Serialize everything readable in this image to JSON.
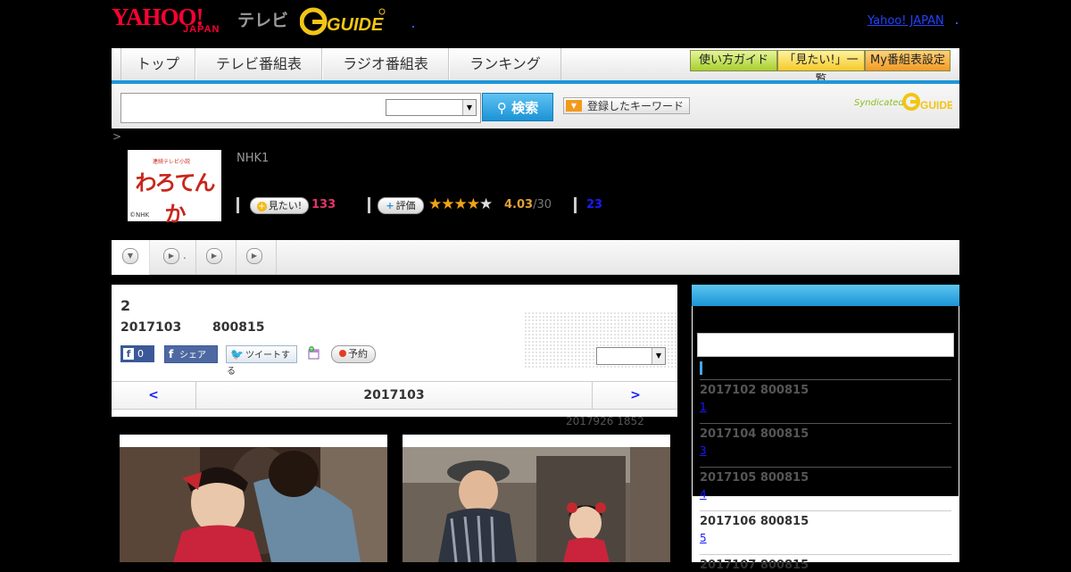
{
  "header": {
    "logo_yahoo": "YAHOO!",
    "logo_japan": "JAPAN",
    "logo_tv": "テレビ",
    "logo_gguide": "G-GUIDE",
    "yahoo_japan_link": "Yahoo! JAPAN"
  },
  "nav": {
    "tabs": [
      "トップ",
      "テレビ番組表",
      "ラジオ番組表",
      "ランキング"
    ],
    "guide_buttons": [
      "使い方ガイド",
      "「見たい!」一覧",
      "My番組表設定"
    ]
  },
  "search": {
    "query": "",
    "select_value": "",
    "button_label": "検索",
    "keyword_button_label": "登録したキーワード",
    "syndicated_label": "Syndicated"
  },
  "breadcrumb": ">",
  "program": {
    "thumbnail_title": "わろてんか",
    "thumbnail_subtitle": "連続テレビ小説",
    "thumbnail_credit": "©NHK",
    "channel": "NHK1",
    "mitai_label": "見たい!",
    "mitai_count": "133",
    "hyoka_label": "評価",
    "rating": 4.03,
    "rating_text": "4.03",
    "rating_count": "/30",
    "review_count": "23"
  },
  "tabs_row": {
    "second_tab_text": "."
  },
  "episode": {
    "number": "2",
    "date": "2017103",
    "time": "800815",
    "fb_like_count": "0",
    "fb_share_label": "シェア",
    "tweet_label": "ツイートする",
    "reserve_label": "予約",
    "dropdown_value": "",
    "pager_prev": "<",
    "pager_current": "2017103",
    "pager_next": ">",
    "updated": "2017926  1852"
  },
  "sidebar": {
    "search_value": "",
    "items": [
      {
        "date": "2017102  800815",
        "link": "1"
      },
      {
        "date": "2017104  800815",
        "link": "3"
      },
      {
        "date": "2017105  800815",
        "link": "4"
      },
      {
        "date": "2017106  800815",
        "link": "5"
      },
      {
        "date": "2017107  800815",
        "link": ""
      }
    ]
  },
  "colors": {
    "accent_blue": "#1e96d8",
    "yahoo_red": "#ff0033",
    "star": "#f1a415",
    "mitai_count": "#e3336a"
  }
}
